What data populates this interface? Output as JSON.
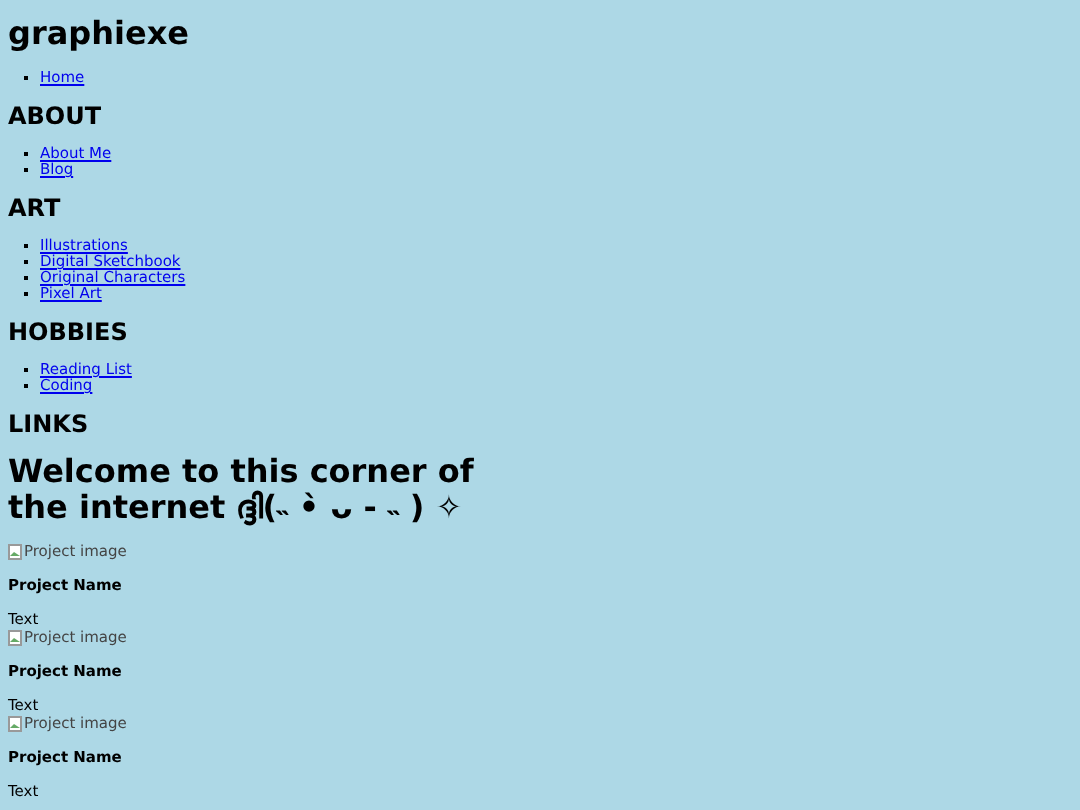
{
  "site_title": "graphiexe",
  "nav": [
    {
      "links": [
        "Home"
      ]
    },
    {
      "heading": "ABOUT",
      "links": [
        "About Me",
        "Blog"
      ]
    },
    {
      "heading": "ART",
      "links": [
        "Illustrations",
        "Digital Sketchbook",
        "Original Characters",
        "Pixel Art"
      ]
    },
    {
      "heading": "HOBBIES",
      "links": [
        "Reading List",
        "Coding"
      ]
    },
    {
      "heading": "LINKS"
    }
  ],
  "welcome": "Welcome to this corner of the internet ദ്ദി(˵ •̀ ᴗ - ˵ ) ✧",
  "projects": [
    {
      "image_alt": "Project image",
      "name": "Project Name",
      "text": "Text"
    },
    {
      "image_alt": "Project image",
      "name": "Project Name",
      "text": "Text"
    },
    {
      "image_alt": "Project image",
      "name": "Project Name",
      "text": "Text"
    }
  ]
}
